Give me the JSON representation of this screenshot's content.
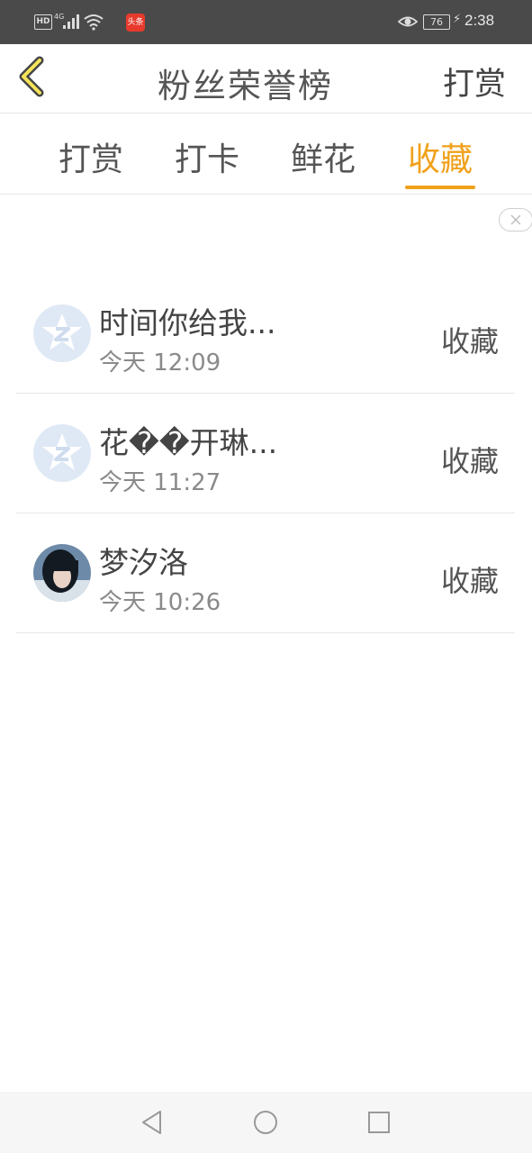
{
  "status_bar": {
    "hd_label": "HD",
    "network": "4G",
    "app_badge": "头条",
    "battery": "76",
    "time": "2:38"
  },
  "header": {
    "title": "粉丝荣誉榜",
    "action_label": "打赏"
  },
  "tabs": [
    {
      "label": "打赏",
      "active": false
    },
    {
      "label": "打卡",
      "active": false
    },
    {
      "label": "鲜花",
      "active": false
    },
    {
      "label": "收藏",
      "active": true
    }
  ],
  "accent_color": "#f0a11b",
  "list": [
    {
      "name": "时间你给我...",
      "time": "今天 12:09",
      "action": "收藏",
      "avatar": "default-star-avatar"
    },
    {
      "name": "花��开琳...",
      "time": "今天 11:27",
      "action": "收藏",
      "avatar": "default-star-avatar"
    },
    {
      "name": "梦汐洛",
      "time": "今天 10:26",
      "action": "收藏",
      "avatar": "photo-avatar"
    }
  ]
}
